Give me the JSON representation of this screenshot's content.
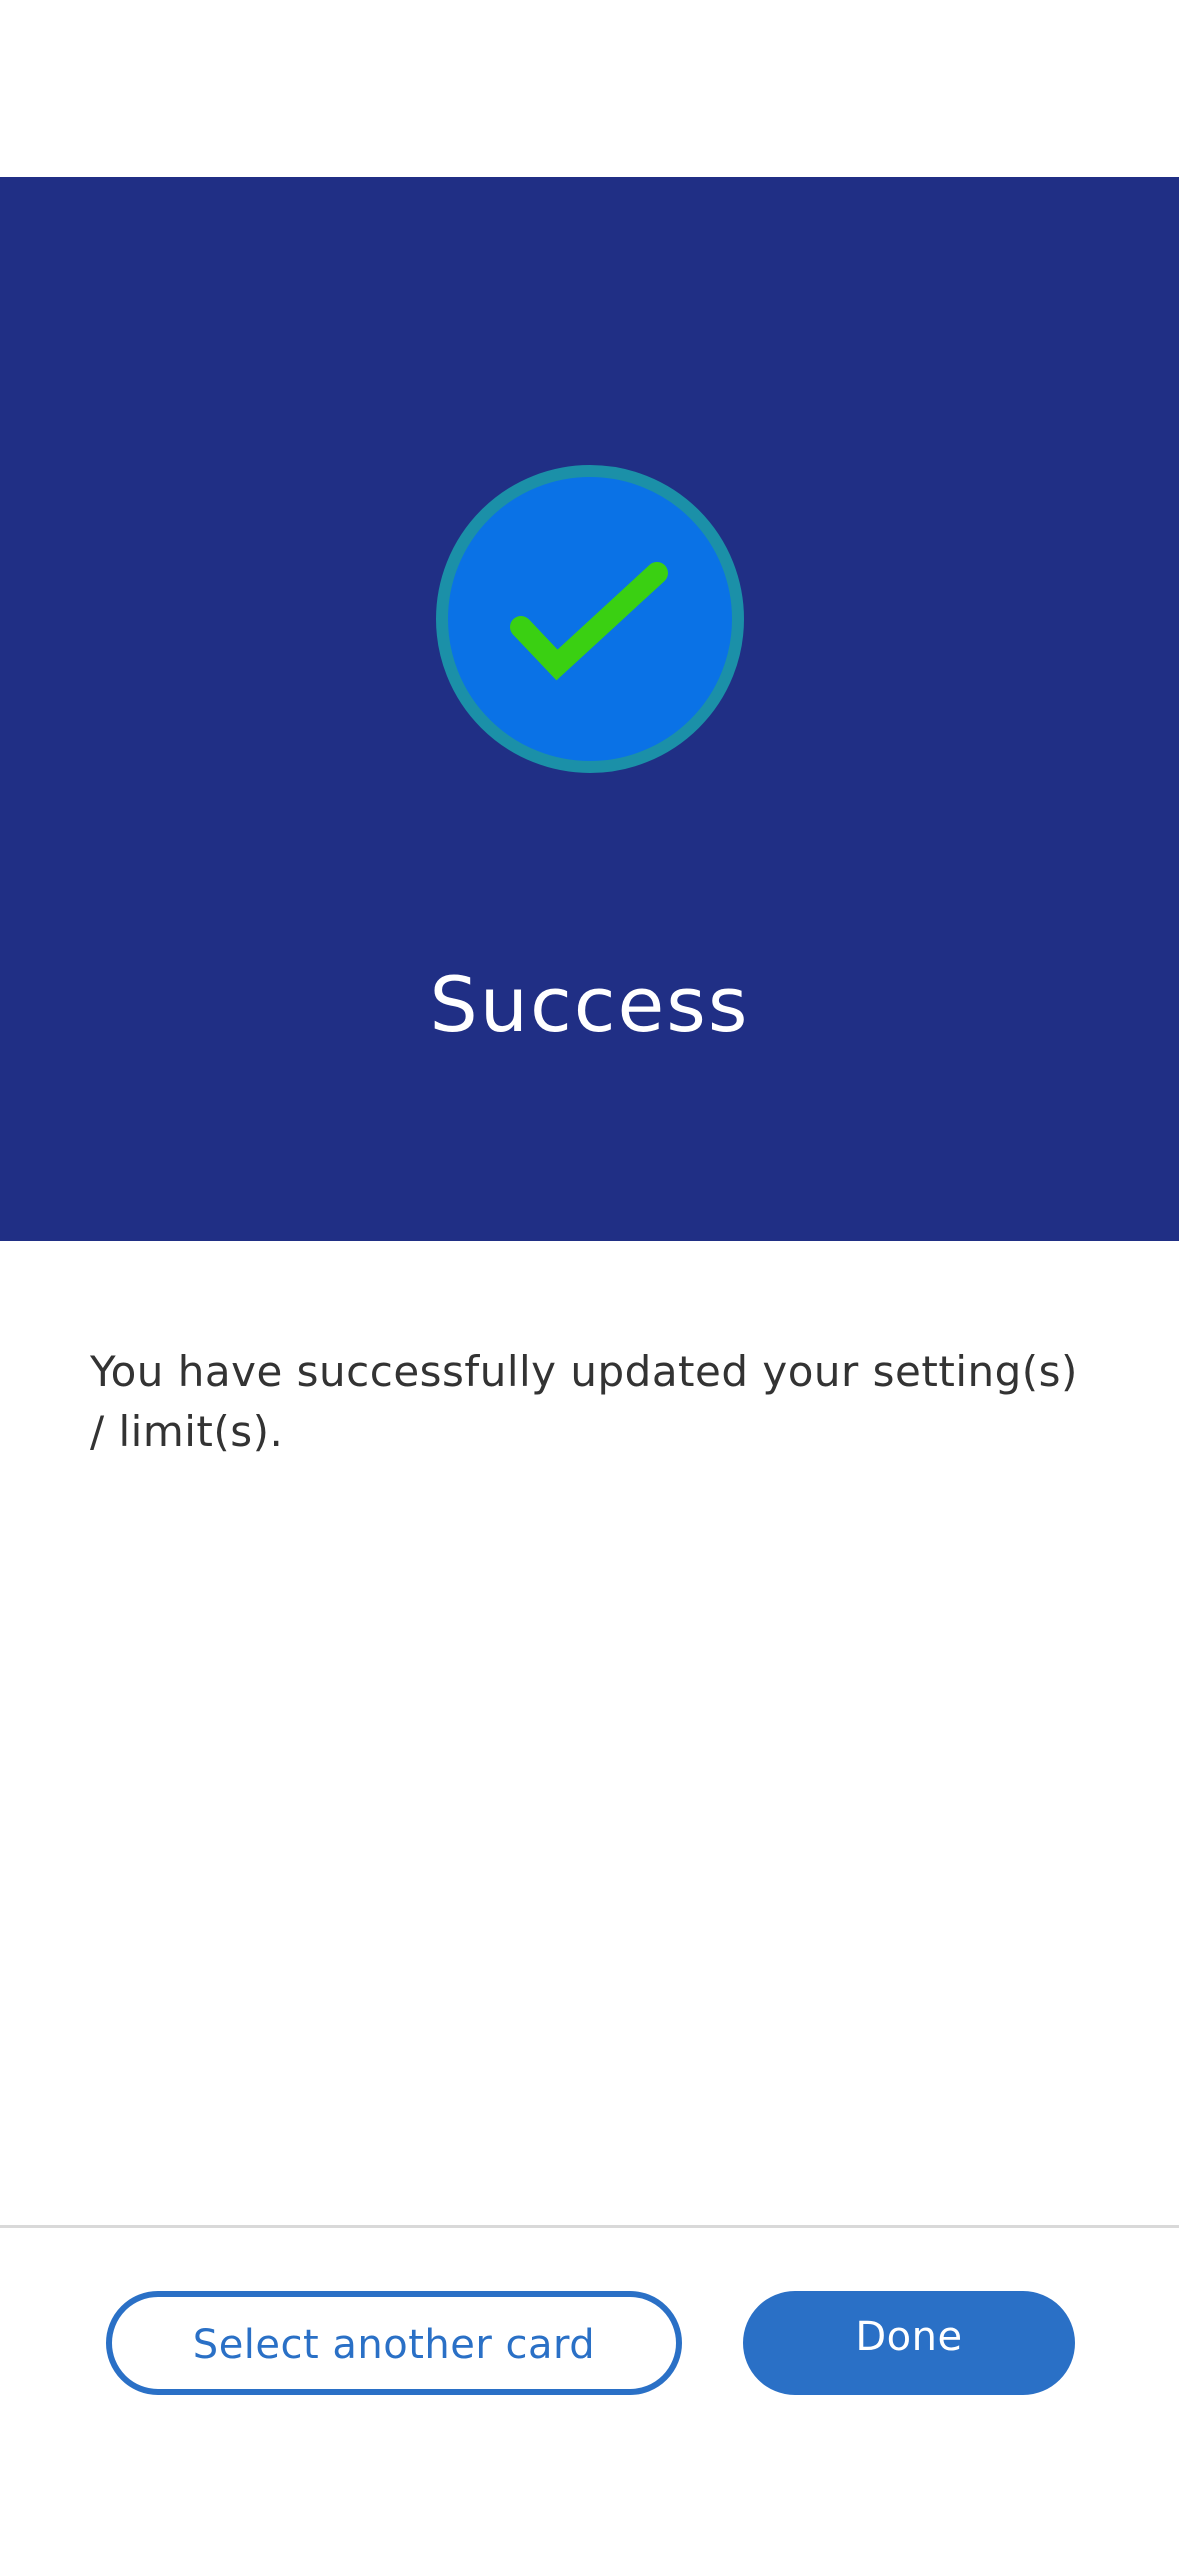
{
  "hero": {
    "title": "Success",
    "icon": "check-circle-icon",
    "colors": {
      "background": "#202f85",
      "circle_fill": "#0a72e6",
      "circle_ring": "#1b90a8",
      "check": "#3ad012"
    }
  },
  "body": {
    "message": "You have successfully updated your setting(s) / limit(s)."
  },
  "footer": {
    "secondary_label": "Select another card",
    "primary_label": "Done",
    "accent": "#2a70c6"
  }
}
